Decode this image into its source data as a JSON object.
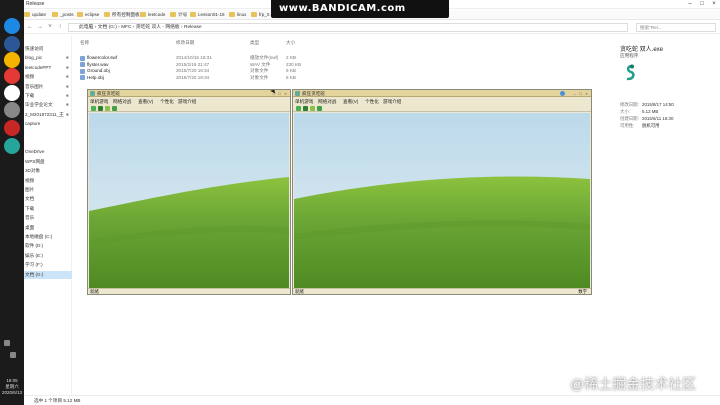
{
  "recorder": {
    "banner": "www.BANDICAM.com"
  },
  "watermark": "@稀土掘金技术社区",
  "taskbar": {
    "time": "16:05",
    "weekday": "星期六",
    "date": "2020/6/13"
  },
  "window": {
    "title": "Release",
    "favorites": [
      "update",
      "_posts",
      "eclipse",
      "所有控制面板项",
      "leetcode",
      "计号",
      "Lesson01-15",
      "linux",
      "frp_0.29.1_window...",
      "leetcodePPT",
      "播放",
      "v2rayN"
    ],
    "address": "此电脑 › 文档 (G:) › MFC › 贪吃蛇 双人 - 网络板 › Release",
    "search_placeholder": "搜索\"Rel..."
  },
  "sidebar": {
    "items": [
      {
        "label": "快速访问",
        "pinned": false
      },
      {
        "label": "blog_pic",
        "pinned": true
      },
      {
        "label": "leetcodePPT",
        "pinned": true
      },
      {
        "label": "视频",
        "pinned": true
      },
      {
        "label": "音乐图片",
        "pinned": true
      },
      {
        "label": "下载",
        "pinned": true
      },
      {
        "label": "毕业学业论文",
        "pinned": true
      },
      {
        "label": "2_M201872311_王",
        "pinned": true
      },
      {
        "label": "capture",
        "pinned": false
      },
      {
        "label": "",
        "pinned": false
      },
      {
        "label": "",
        "pinned": false
      },
      {
        "label": "OneDrive",
        "pinned": false
      },
      {
        "label": "WPS网盘",
        "pinned": false
      },
      {
        "label": "3D对象",
        "pinned": false
      },
      {
        "label": "视频",
        "pinned": false
      },
      {
        "label": "图片",
        "pinned": false
      },
      {
        "label": "文档",
        "pinned": false
      },
      {
        "label": "下载",
        "pinned": false
      },
      {
        "label": "音乐",
        "pinned": false
      },
      {
        "label": "桌面",
        "pinned": false
      },
      {
        "label": "本地磁盘 (C:)",
        "pinned": false
      },
      {
        "label": "软件 (D:)",
        "pinned": false
      },
      {
        "label": "娱乐 (E:)",
        "pinned": false
      },
      {
        "label": "学习 (F:)",
        "pinned": false
      },
      {
        "label": "文档 (G:)",
        "pinned": false,
        "selected": true
      }
    ]
  },
  "file_list": {
    "headers": [
      "名称",
      "修改日期",
      "类型",
      "大小"
    ],
    "rows": [
      {
        "name": "flowercolor.swf",
        "date": "2014/10/15 16:31",
        "type": "播放文件(swf)",
        "size": "2 KB"
      },
      {
        "name": "flyster.wav",
        "date": "2015/2/19 21:47",
        "type": "WAV 文件",
        "size": "230 KB"
      },
      {
        "name": "Ground.obj",
        "date": "2015/7/20 19:34",
        "type": "对象文件",
        "size": "6 KB"
      },
      {
        "name": "Help.obj",
        "date": "2015/7/20 19:34",
        "type": "对象文件",
        "size": "6 KB"
      }
    ]
  },
  "details": {
    "name": "贪吃蛇 双人.exe",
    "type": "应用程序",
    "fields": [
      {
        "label": "修改日期:",
        "value": "2015/8/17 14:50"
      },
      {
        "label": "大小:",
        "value": "5.12 MB"
      },
      {
        "label": "创建日期:",
        "value": "2015/6/11 16:30"
      },
      {
        "label": "可用性:",
        "value": "脱机可用"
      }
    ]
  },
  "status": {
    "text": "选中 1 个项目  5.12 MB"
  },
  "game_windows": [
    {
      "title": "疯狂贪吃蛇",
      "menu": [
        "单机游戏",
        "网络对战",
        "查看(V)",
        "个性化",
        "游戏介绍"
      ],
      "status_left": "就绪",
      "status_right": ""
    },
    {
      "title": "疯狂贪吃蛇",
      "menu": [
        "单机游戏",
        "网络对战",
        "查看(V)",
        "个性化",
        "游戏介绍"
      ],
      "status_left": "就绪",
      "status_right": "数字"
    }
  ],
  "colors": {
    "taskbar": "#1b1b1b",
    "game_chrome": "#ece8d8",
    "grass": "#6aa535",
    "sky": "#cfe3ef"
  }
}
